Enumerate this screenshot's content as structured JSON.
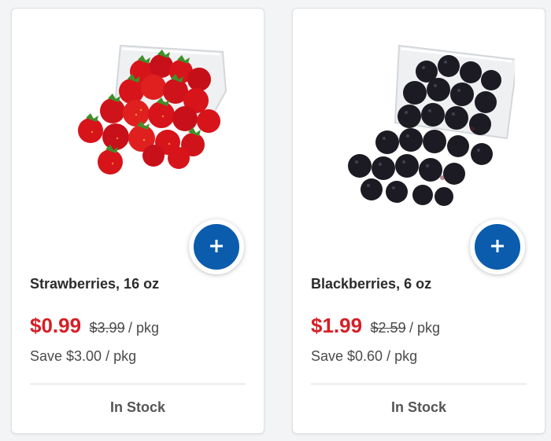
{
  "products": [
    {
      "name": "Strawberries, 16 oz",
      "price": "$0.99",
      "was_price": "$3.99",
      "unit": "/ pkg",
      "savings": "Save $3.00 / pkg",
      "stock": "In Stock",
      "image_icon": "strawberries-image"
    },
    {
      "name": "Blackberries, 6 oz",
      "price": "$1.99",
      "was_price": "$2.59",
      "unit": "/ pkg",
      "savings": "Save $0.60 / pkg",
      "stock": "In Stock",
      "image_icon": "blackberries-image"
    }
  ],
  "add_button_icon": "plus-icon",
  "colors": {
    "sale_price": "#d61f26",
    "add_button": "#0b5cad",
    "card_border": "#dfe1e5"
  }
}
